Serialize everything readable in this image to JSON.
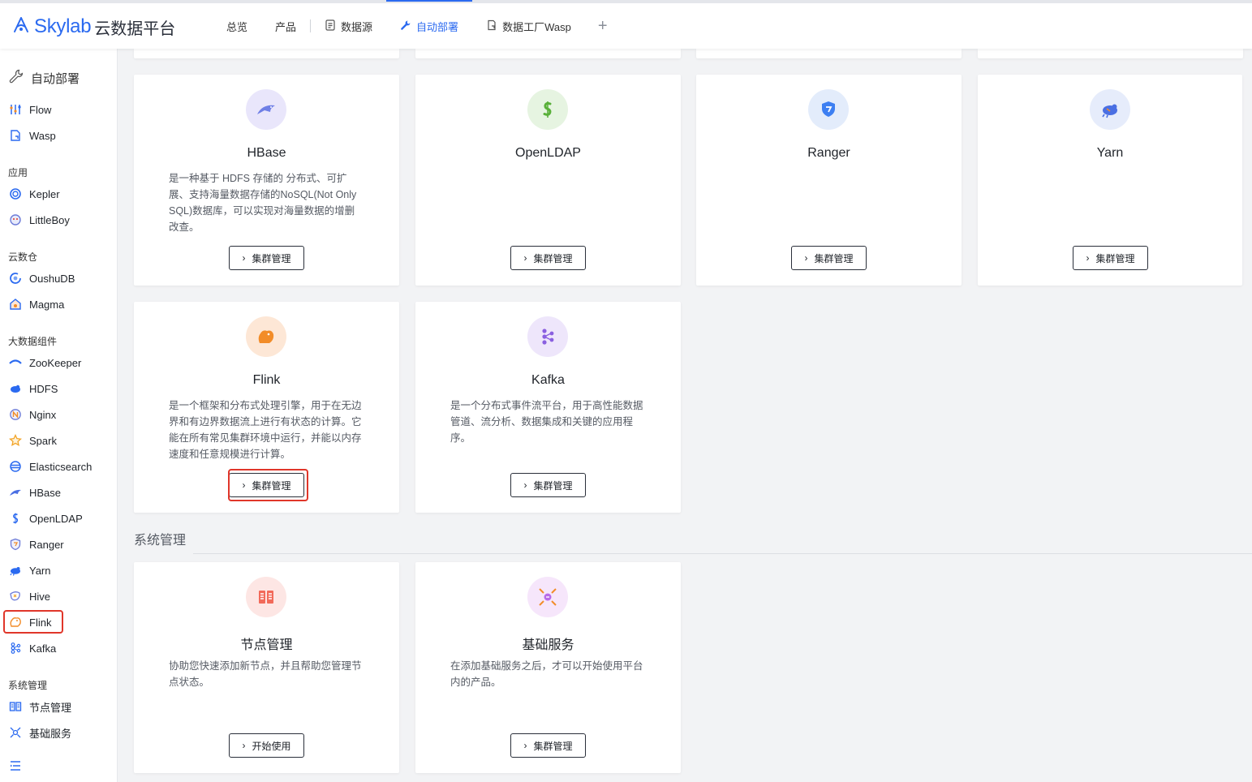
{
  "header": {
    "brand": "Skylab",
    "brand_sub": "云数据平台",
    "nav": [
      {
        "label": "总览",
        "icon": ""
      },
      {
        "label": "产品",
        "icon": ""
      },
      {
        "label": "数据源",
        "icon": "document-icon"
      },
      {
        "label": "自动部署",
        "icon": "wrench-icon",
        "active": true
      },
      {
        "label": "数据工厂Wasp",
        "icon": "factory-icon"
      }
    ],
    "add_tab": "+"
  },
  "sidebar": {
    "head": "自动部署",
    "top_items": [
      "Flow",
      "Wasp"
    ],
    "groups": [
      {
        "title": "应用",
        "items": [
          "Kepler",
          "LittleBoy"
        ]
      },
      {
        "title": "云数仓",
        "items": [
          "OushuDB",
          "Magma"
        ]
      },
      {
        "title": "大数据组件",
        "items": [
          "ZooKeeper",
          "HDFS",
          "Nginx",
          "Spark",
          "Elasticsearch",
          "HBase",
          "OpenLDAP",
          "Ranger",
          "Yarn",
          "Hive",
          "Flink",
          "Kafka"
        ]
      },
      {
        "title": "系统管理",
        "items": [
          "节点管理",
          "基础服务"
        ]
      }
    ],
    "highlighted_item": "Flink"
  },
  "cards": [
    {
      "title": "HBase",
      "desc": "是一种基于 HDFS 存储的 分布式、可扩展、支持海量数据存储的NoSQL(Not Only SQL)数据库，可以实现对海量数据的增删改查。",
      "button": "集群管理",
      "icon_color": "#e9e6fb",
      "icon": "hbase-icon"
    },
    {
      "title": "OpenLDAP",
      "desc": "",
      "button": "集群管理",
      "icon_color": "#e6f4e1",
      "icon": "openldap-icon"
    },
    {
      "title": "Ranger",
      "desc": "",
      "button": "集群管理",
      "icon_color": "#e3ecfb",
      "icon": "ranger-icon"
    },
    {
      "title": "Yarn",
      "desc": "",
      "button": "集群管理",
      "icon_color": "#e6ecfb",
      "icon": "yarn-icon"
    },
    {
      "title": "Flink",
      "desc": "是一个框架和分布式处理引擎，用于在无边界和有边界数据流上进行有状态的计算。它能在所有常见集群环境中运行，并能以内存速度和任意规模进行计算。",
      "button": "集群管理",
      "icon_color": "#fde7d6",
      "icon": "flink-icon",
      "highlighted": true
    },
    {
      "title": "Kafka",
      "desc": "是一个分布式事件流平台，用于高性能数据管道、流分析、数据集成和关键的应用程序。",
      "button": "集群管理",
      "icon_color": "#eee6fb",
      "icon": "kafka-icon"
    }
  ],
  "system": {
    "section_title": "系统管理",
    "cards": [
      {
        "title": "节点管理",
        "desc": "协助您快速添加新节点，并且帮助您管理节点状态。",
        "button": "开始使用",
        "icon_color": "#fde6e4",
        "icon": "node-icon"
      },
      {
        "title": "基础服务",
        "desc": "在添加基础服务之后，才可以开始使用平台内的产品。",
        "button": "集群管理",
        "icon_color": "#f6e6fb",
        "icon": "base-service-icon"
      }
    ]
  },
  "colors": {
    "accent": "#2b6af0",
    "highlight": "#e0362a"
  }
}
